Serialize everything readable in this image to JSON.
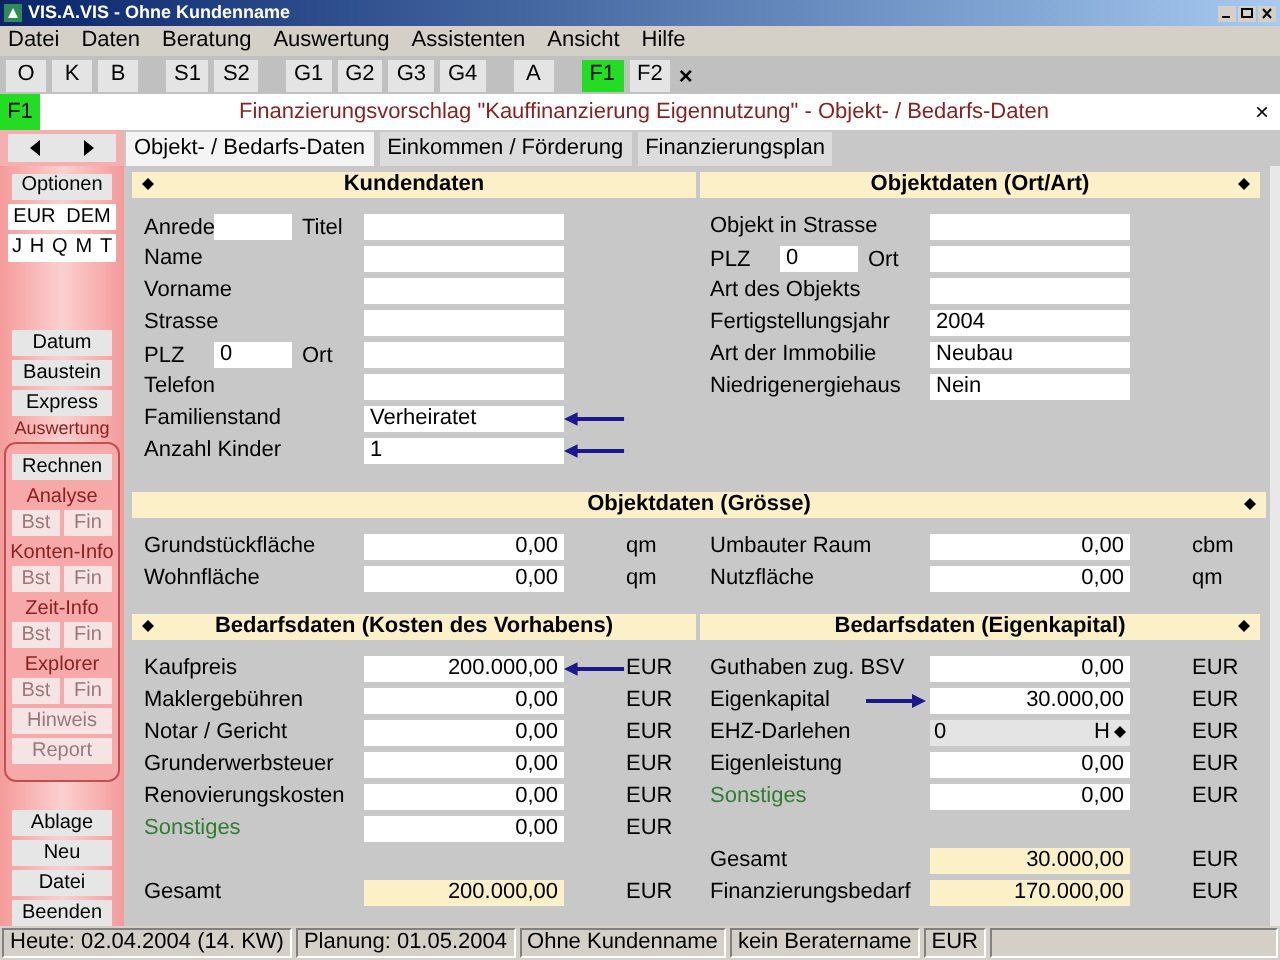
{
  "window": {
    "title": "VIS.A.VIS - Ohne Kundenname"
  },
  "menu": [
    "Datei",
    "Daten",
    "Beratung",
    "Auswertung",
    "Assistenten",
    "Ansicht",
    "Hilfe"
  ],
  "toolbar": [
    [
      {
        "label": "O",
        "selected": false
      },
      {
        "label": "K",
        "selected": false
      },
      {
        "label": "B",
        "selected": false
      }
    ],
    [
      {
        "label": "S1",
        "selected": false
      },
      {
        "label": "S2",
        "selected": false
      }
    ],
    [
      {
        "label": "G1",
        "selected": false
      },
      {
        "label": "G2",
        "selected": false
      },
      {
        "label": "G3",
        "selected": false
      },
      {
        "label": "G4",
        "selected": false
      }
    ],
    [
      {
        "label": "A",
        "selected": false
      }
    ],
    [
      {
        "label": "F1",
        "selected": true
      },
      {
        "label": "F2",
        "selected": false
      }
    ]
  ],
  "toolbar_close": "×",
  "form_header": {
    "badge": "F1",
    "title": "Finanzierungsvorschlag \"Kauffinanzierung Eigennutzung\" - Objekt- / Bedarfs-Daten",
    "close": "×"
  },
  "tabs": [
    {
      "label": "Objekt- / Bedarfs-Daten",
      "selected": true
    },
    {
      "label": "Einkommen / Förderung",
      "selected": false
    },
    {
      "label": "Finanzierungsplan",
      "selected": false
    }
  ],
  "sidebar": {
    "top": [
      "Optionen"
    ],
    "currency": [
      "EUR",
      "DEM"
    ],
    "periods": [
      "J",
      "H",
      "Q",
      "M",
      "T"
    ],
    "middle": [
      "Datum",
      "Baustein",
      "Express"
    ],
    "group_title": "Auswertung",
    "group_button": "Rechnen",
    "group_sections": [
      {
        "title": "Analyse",
        "buttons": [
          {
            "label": "Bst",
            "disabled": true
          },
          {
            "label": "Fin",
            "disabled": true
          }
        ]
      },
      {
        "title": "Konten-Info",
        "buttons": [
          {
            "label": "Bst",
            "disabled": true
          },
          {
            "label": "Fin",
            "disabled": true
          }
        ]
      },
      {
        "title": "Zeit-Info",
        "buttons": [
          {
            "label": "Bst",
            "disabled": true
          },
          {
            "label": "Fin",
            "disabled": true
          }
        ]
      },
      {
        "title": "Explorer",
        "buttons": [
          {
            "label": "Bst",
            "disabled": true
          },
          {
            "label": "Fin",
            "disabled": true
          }
        ]
      }
    ],
    "group_extra": [
      {
        "label": "Hinweis",
        "disabled": true
      },
      {
        "label": "Report",
        "disabled": true
      }
    ],
    "bottom": [
      "Ablage",
      "Neu",
      "Datei",
      "Beenden"
    ]
  },
  "kundendaten": {
    "title": "Kundendaten",
    "marker_left": true,
    "rows": [
      {
        "kind": "pair",
        "label": "Anrede",
        "label2": "Titel"
      },
      {
        "kind": "text",
        "label": "Name"
      },
      {
        "kind": "text",
        "label": "Vorname"
      },
      {
        "kind": "text",
        "label": "Strasse"
      },
      {
        "kind": "pair",
        "label": "PLZ",
        "value": "0",
        "label2": "Ort"
      },
      {
        "kind": "text",
        "label": "Telefon"
      },
      {
        "kind": "text",
        "label": "Familienstand",
        "value": "Verheiratet",
        "arrow_left": true
      },
      {
        "kind": "text",
        "label": "Anzahl Kinder",
        "value": "1",
        "arrow_left": true
      }
    ]
  },
  "objektdaten_ort": {
    "title": "Objektdaten (Ort/Art)",
    "marker_right": true,
    "rows": [
      {
        "kind": "text",
        "label": "Objekt in Strasse"
      },
      {
        "kind": "pair",
        "label": "PLZ",
        "value": "0",
        "label2": "Ort"
      },
      {
        "kind": "text",
        "label": "Art des Objekts"
      },
      {
        "kind": "text",
        "label": "Fertigstellungsjahr",
        "value": "2004"
      },
      {
        "kind": "text",
        "label": "Art der Immobilie",
        "value": "Neubau"
      },
      {
        "kind": "text",
        "label": "Niedrigenergiehaus",
        "value": "Nein"
      }
    ]
  },
  "objektdaten_groesse": {
    "title": "Objektdaten (Grösse)",
    "marker_right": true,
    "left_rows": [
      {
        "kind": "number",
        "label": "Grundstückfläche",
        "value": "0,00",
        "unit": "qm"
      },
      {
        "kind": "number",
        "label": "Wohnfläche",
        "value": "0,00",
        "unit": "qm"
      }
    ],
    "right_rows": [
      {
        "kind": "number",
        "label": "Umbauter Raum",
        "value": "0,00",
        "unit": "cbm"
      },
      {
        "kind": "number",
        "label": "Nutzfläche",
        "value": "0,00",
        "unit": "qm"
      }
    ]
  },
  "bedarf_kosten": {
    "title": "Bedarfsdaten (Kosten des Vorhabens)",
    "marker_left": true,
    "rows": [
      {
        "kind": "number",
        "label": "Kaufpreis",
        "value": "200.000,00",
        "unit": "EUR",
        "arrow_left": true
      },
      {
        "kind": "number",
        "label": "Maklergebühren",
        "value": "0,00",
        "unit": "EUR"
      },
      {
        "kind": "number",
        "label": "Notar / Gericht",
        "value": "0,00",
        "unit": "EUR"
      },
      {
        "kind": "number",
        "label": "Grunderwerbsteuer",
        "value": "0,00",
        "unit": "EUR"
      },
      {
        "kind": "number",
        "label": "Renovierungskosten",
        "value": "0,00",
        "unit": "EUR"
      },
      {
        "kind": "number",
        "label": "Sonstiges",
        "value": "0,00",
        "unit": "EUR",
        "accent": true
      },
      {
        "kind": "blank"
      },
      {
        "kind": "total",
        "label": "Gesamt",
        "value": "200.000,00",
        "unit": "EUR"
      }
    ]
  },
  "bedarf_eigenkapital": {
    "title": "Bedarfsdaten (Eigenkapital)",
    "marker_right": true,
    "rows": [
      {
        "kind": "number",
        "label": "Guthaben zug. BSV",
        "value": "0,00",
        "unit": "EUR"
      },
      {
        "kind": "number",
        "label": "Eigenkapital",
        "value": "30.000,00",
        "unit": "EUR",
        "arrow_right": true
      },
      {
        "kind": "select",
        "label": "EHZ-Darlehen",
        "value": "0",
        "suffix": "H",
        "unit": "EUR"
      },
      {
        "kind": "number",
        "label": "Eigenleistung",
        "value": "0,00",
        "unit": "EUR"
      },
      {
        "kind": "number",
        "label": "Sonstiges",
        "value": "0,00",
        "unit": "EUR",
        "accent": true
      },
      {
        "kind": "blank"
      },
      {
        "kind": "total",
        "label": "Gesamt",
        "value": "30.000,00",
        "unit": "EUR"
      },
      {
        "kind": "total",
        "label": "Finanzierungsbedarf",
        "value": "170.000,00",
        "unit": "EUR"
      }
    ]
  },
  "status_bar": [
    "Heute: 02.04.2004 (14. KW)",
    "Planung: 01.05.2004",
    "Ohne Kundenname",
    "kein Beratername",
    "EUR"
  ]
}
